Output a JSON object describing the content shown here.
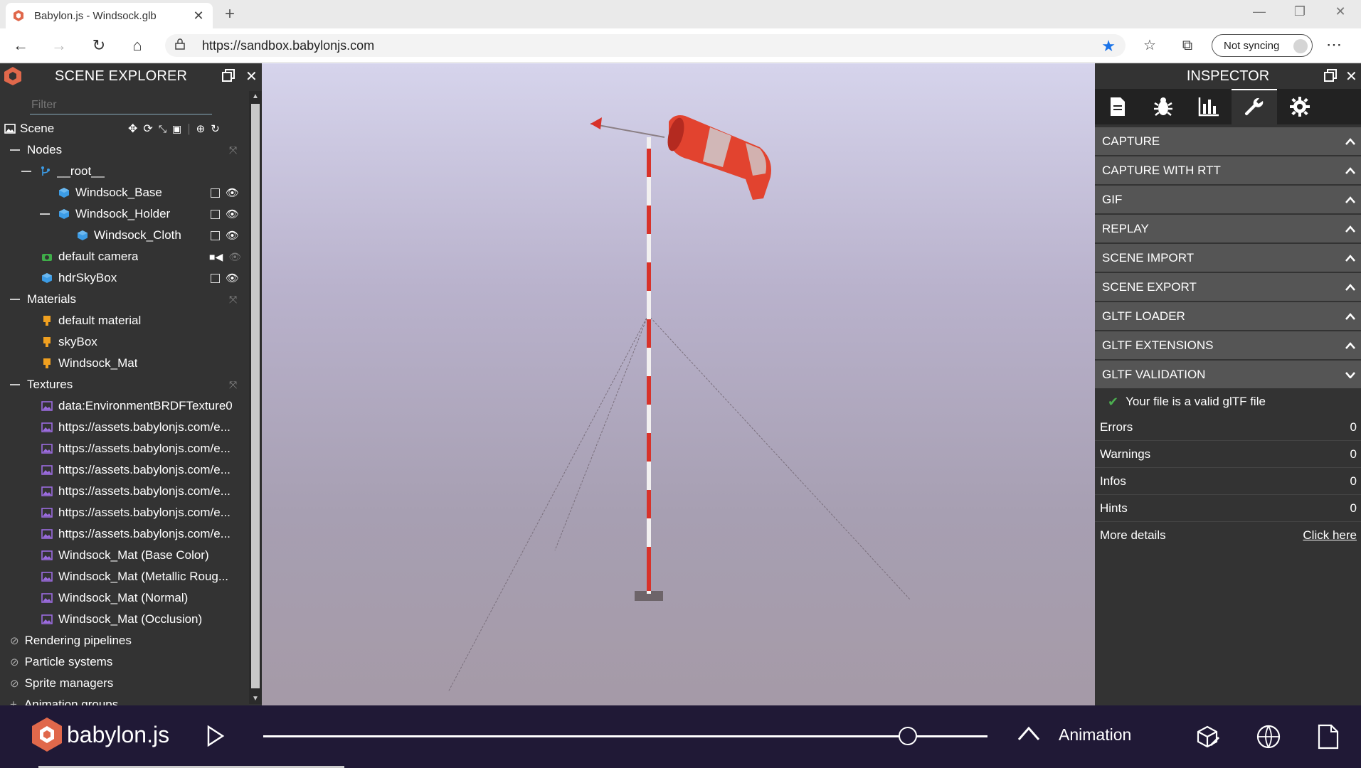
{
  "browser": {
    "tab_title": "Babylon.js - Windsock.glb",
    "url": "https://sandbox.babylonjs.com",
    "sync_label": "Not syncing"
  },
  "explorer": {
    "title": "SCENE EXPLORER",
    "filter_placeholder": "Filter",
    "scene_label": "Scene",
    "items": [
      {
        "label": "Nodes"
      },
      {
        "label": "__root__"
      },
      {
        "label": "Windsock_Base"
      },
      {
        "label": "Windsock_Holder"
      },
      {
        "label": "Windsock_Cloth"
      },
      {
        "label": "default camera"
      },
      {
        "label": "hdrSkyBox"
      },
      {
        "label": "Materials"
      },
      {
        "label": "default material"
      },
      {
        "label": "skyBox"
      },
      {
        "label": "Windsock_Mat"
      },
      {
        "label": "Textures"
      },
      {
        "label": "data:EnvironmentBRDFTexture0"
      },
      {
        "label": "https://assets.babylonjs.com/e..."
      },
      {
        "label": "https://assets.babylonjs.com/e..."
      },
      {
        "label": "https://assets.babylonjs.com/e..."
      },
      {
        "label": "https://assets.babylonjs.com/e..."
      },
      {
        "label": "https://assets.babylonjs.com/e..."
      },
      {
        "label": "https://assets.babylonjs.com/e..."
      },
      {
        "label": "Windsock_Mat (Base Color)"
      },
      {
        "label": "Windsock_Mat (Metallic Roug..."
      },
      {
        "label": "Windsock_Mat (Normal)"
      },
      {
        "label": "Windsock_Mat (Occlusion)"
      },
      {
        "label": "Rendering pipelines"
      },
      {
        "label": "Particle systems"
      },
      {
        "label": "Sprite managers"
      },
      {
        "label": "Animation groups"
      }
    ]
  },
  "inspector": {
    "title": "INSPECTOR",
    "sections": [
      {
        "label": "CAPTURE"
      },
      {
        "label": "CAPTURE WITH RTT"
      },
      {
        "label": "GIF"
      },
      {
        "label": "REPLAY"
      },
      {
        "label": "SCENE IMPORT"
      },
      {
        "label": "SCENE EXPORT"
      },
      {
        "label": "GLTF LOADER"
      },
      {
        "label": "GLTF EXTENSIONS"
      },
      {
        "label": "GLTF VALIDATION"
      }
    ],
    "validation": {
      "message": "Your file is a valid glTF file",
      "errors_label": "Errors",
      "errors": "0",
      "warnings_label": "Warnings",
      "warnings": "0",
      "infos_label": "Infos",
      "infos": "0",
      "hints_label": "Hints",
      "hints": "0",
      "more_label": "More details",
      "more_link": "Click here"
    }
  },
  "footer": {
    "brand": "babylon.js",
    "animation_label": "Animation",
    "timeline_position": 0.89
  },
  "colors": {
    "panel_bg": "#333333",
    "section_bg": "#555555",
    "footer_bg": "#201936",
    "accent_orange": "#e0684b",
    "windsock_red": "#e2432f"
  }
}
